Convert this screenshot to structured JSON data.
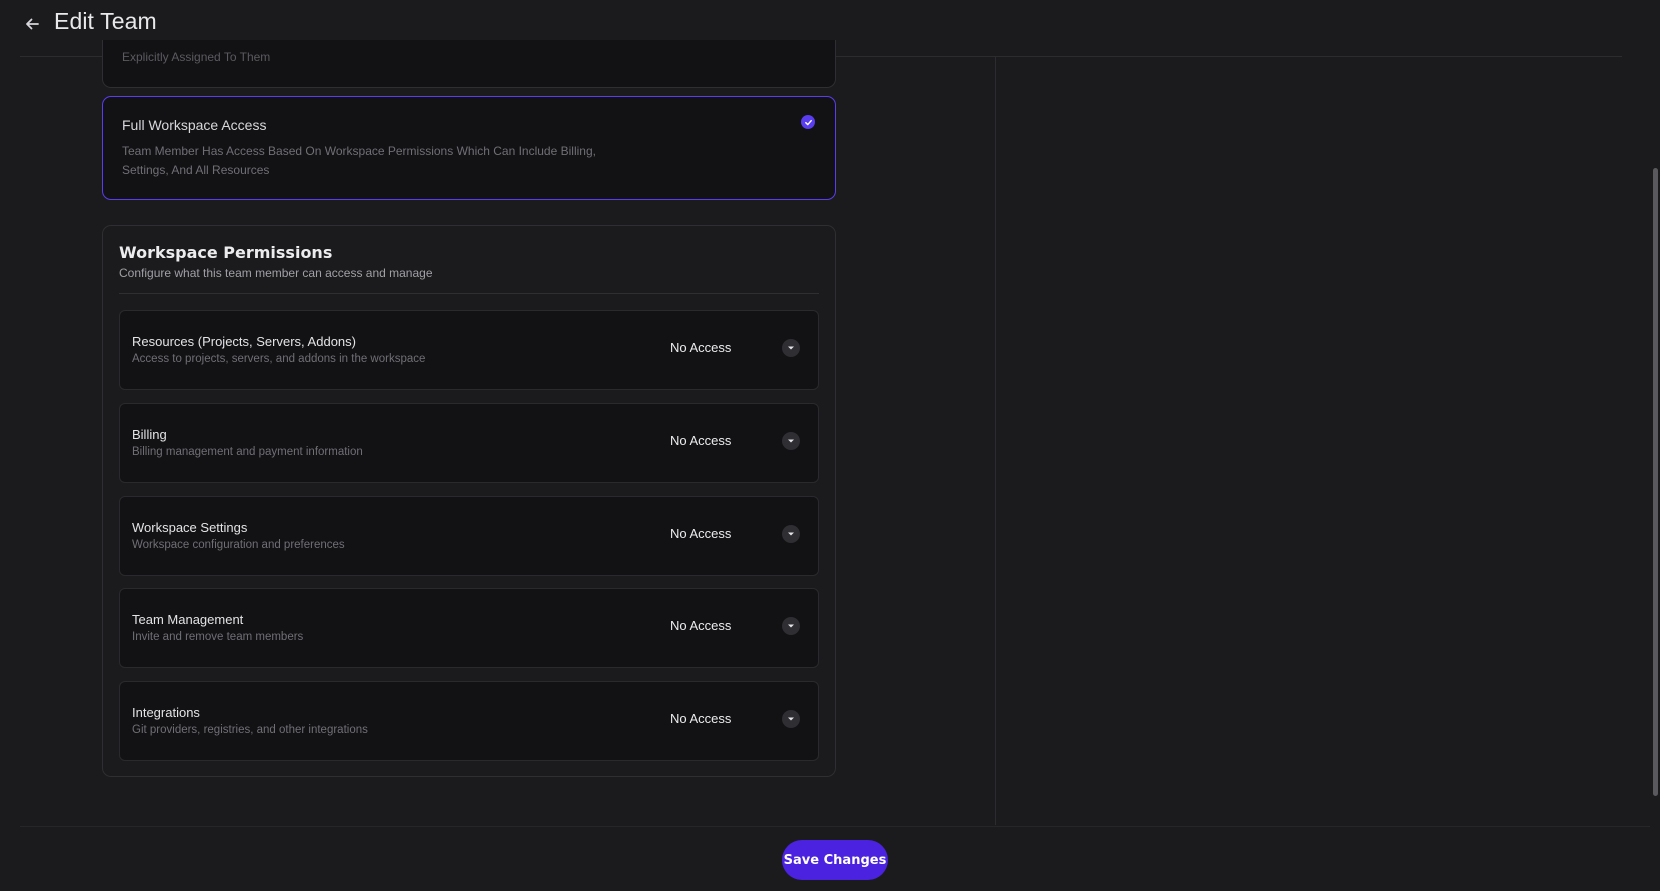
{
  "header": {
    "title": "Edit Team",
    "back_icon": "arrow-left-icon"
  },
  "access_options": {
    "previous_option_text": "Explicitly Assigned To Them",
    "selected": {
      "title": "Full Workspace Access",
      "description": "Team Member Has Access Based On Workspace Permissions Which Can Include Billing, Settings, And All Resources",
      "check_icon": "check-circle-icon",
      "accent_color": "#5b3df0"
    }
  },
  "permissions": {
    "title": "Workspace Permissions",
    "subtitle": "Configure what this team member can access and manage",
    "items": [
      {
        "name": "Resources (Projects, Servers, Addons)",
        "description": "Access to projects, servers, and addons in the workspace",
        "value": "No Access"
      },
      {
        "name": "Billing",
        "description": "Billing management and payment information",
        "value": "No Access"
      },
      {
        "name": "Workspace Settings",
        "description": "Workspace configuration and preferences",
        "value": "No Access"
      },
      {
        "name": "Team Management",
        "description": "Invite and remove team members",
        "value": "No Access"
      },
      {
        "name": "Integrations",
        "description": "Git providers, registries, and other integrations",
        "value": "No Access"
      }
    ]
  },
  "footer": {
    "save_label": "Save Changes",
    "button_color": "#4a22e0"
  }
}
